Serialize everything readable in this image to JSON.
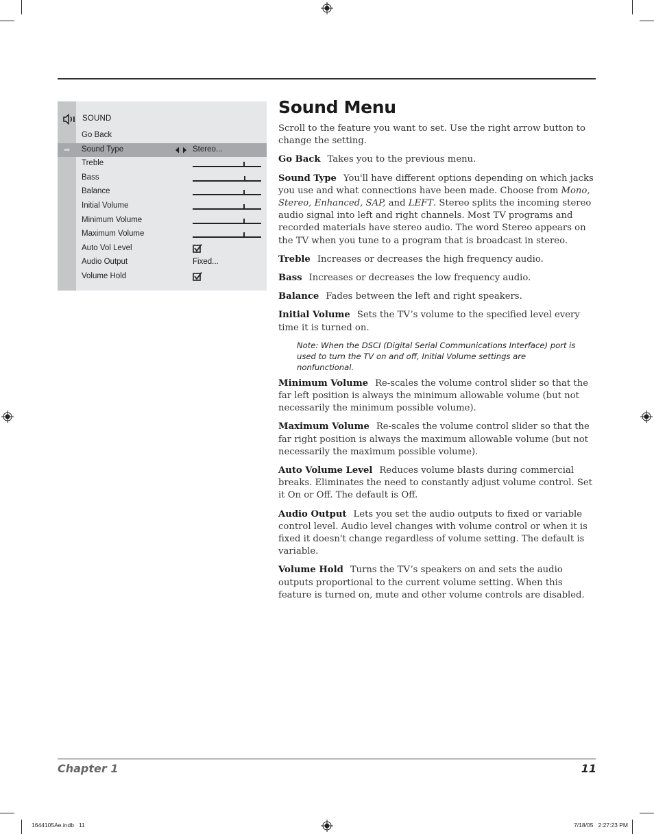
{
  "page": {
    "heading": "Sound Menu",
    "intro": "Scroll to the feature you want to set. Use the right arrow button to change the setting."
  },
  "menu": {
    "icon": "speaker-icon",
    "title": "SOUND",
    "items": [
      {
        "label": "Go Back",
        "type": "text",
        "value": ""
      },
      {
        "label": "Sound Type",
        "type": "select",
        "value": "Stereo...",
        "selected": true
      },
      {
        "label": "Treble",
        "type": "slider",
        "level": 0.74
      },
      {
        "label": "Bass",
        "type": "slider",
        "level": 0.75
      },
      {
        "label": "Balance",
        "type": "slider",
        "level": 0.74
      },
      {
        "label": "Initial Volume",
        "type": "slider",
        "level": 0.74
      },
      {
        "label": "Minimum Volume",
        "type": "slider",
        "level": 0.74
      },
      {
        "label": "Maximum Volume",
        "type": "slider",
        "level": 0.74
      },
      {
        "label": "Auto Vol Level",
        "type": "checkbox",
        "checked": true
      },
      {
        "label": "Audio Output",
        "type": "text",
        "value": "Fixed..."
      },
      {
        "label": "Volume Hold",
        "type": "checkbox",
        "checked": true
      }
    ]
  },
  "descriptions": {
    "go_back": {
      "term": "Go Back",
      "text": "Takes you to the previous menu."
    },
    "sound_type": {
      "term": "Sound Type",
      "text_a": "You'll have different options depending on which jacks you use and what connections have been made. Choose from ",
      "opt_mono": "Mono,",
      "opt_stereo_enh_sap": "Stereo, Enhanced, SAP,",
      "and": " and ",
      "opt_left": "LEFT",
      "text_b": ". Stereo splits the incoming stereo audio signal into left and right channels. Most TV programs and recorded materials have stereo audio. The word Stereo appears on the TV when you tune to a program that is broadcast in stereo."
    },
    "treble": {
      "term": "Treble",
      "text": "Increases or decreases the high frequency audio."
    },
    "bass": {
      "term": "Bass",
      "text": "Increases or decreases the low frequency audio."
    },
    "balance": {
      "term": "Balance",
      "text": "Fades between the left and right speakers."
    },
    "initial_volume": {
      "term": "Initial Volume",
      "text": "Sets the TV’s volume to the specified level every time it is turned on."
    },
    "note": "Note: When the DSCI (Digital Serial Communications Interface) port is used to turn the TV on and off, Initial Volume settings are nonfunctional.",
    "minimum_volume": {
      "term": "Minimum Volume",
      "text": "Re-scales the volume control slider so that the far left position is always the minimum allowable volume (but not necessarily the minimum possible volume)."
    },
    "maximum_volume": {
      "term": "Maximum Volume",
      "text": "Re-scales the volume control slider so that the far right position is always the maximum allowable volume (but not necessarily the maximum possible volume)."
    },
    "auto_volume_level": {
      "term": "Auto Volume Level",
      "text": "Reduces volume blasts during commercial breaks. Eliminates the need to constantly adjust volume control. Set it On or Off. The default is Off."
    },
    "audio_output": {
      "term": "Audio Output",
      "text": "Lets you set the audio outputs to fixed or variable control level. Audio level changes with volume control or when it is fixed it doesn't change regardless of volume setting. The default is variable."
    },
    "volume_hold": {
      "term": "Volume Hold",
      "text": "Turns the TV’s speakers on and sets the audio outputs proportional to the current volume setting. When this feature is turned on, mute and other volume controls are disabled."
    }
  },
  "footer": {
    "chapter": "Chapter 1",
    "page_number": "11",
    "slug_file": "1644105Ae.indb   11",
    "slug_date": "7/18/05   2:27:23 PM"
  }
}
